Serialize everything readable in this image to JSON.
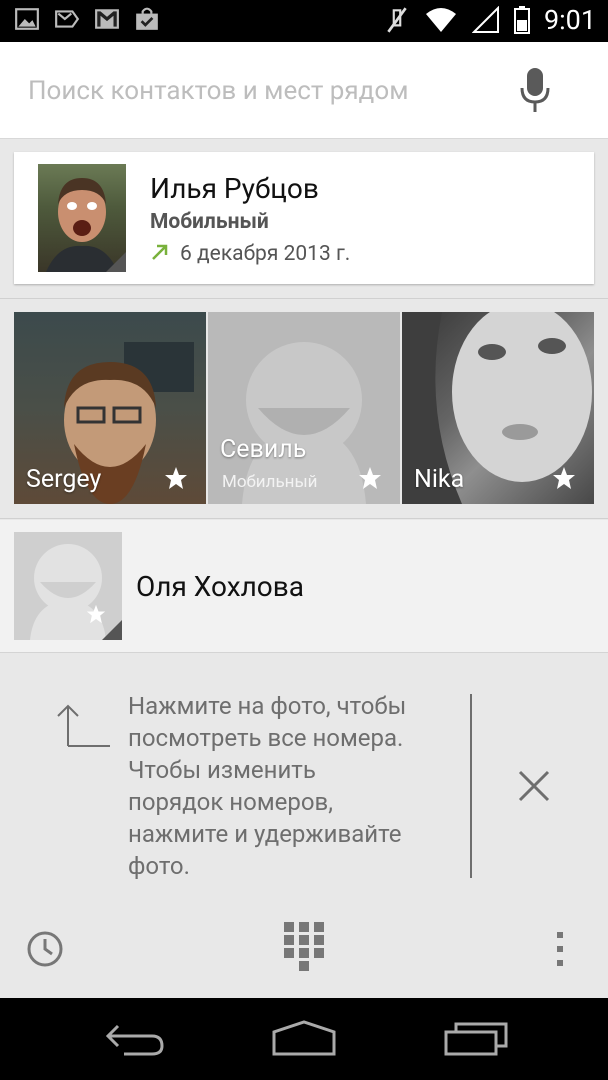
{
  "status": {
    "time": "9:01"
  },
  "search": {
    "placeholder": "Поиск контактов и мест рядом"
  },
  "recent": {
    "name": "Илья Рубцов",
    "type": "Мобильный",
    "date": "6 декабря 2013 г."
  },
  "favorites": [
    {
      "name": "Sergey",
      "sub": ""
    },
    {
      "name": "Севиль",
      "sub": "Мобильный"
    },
    {
      "name": "Nika",
      "sub": ""
    }
  ],
  "contact": {
    "name": "Оля Хохлова"
  },
  "hint": {
    "text_lines": [
      "Нажмите на фото, чтобы",
      "посмотреть все номера.",
      "Чтобы изменить",
      "порядок номеров,",
      "нажмите и удерживайте",
      "фото."
    ]
  },
  "colors": {
    "accent_green": "#79b13b"
  }
}
